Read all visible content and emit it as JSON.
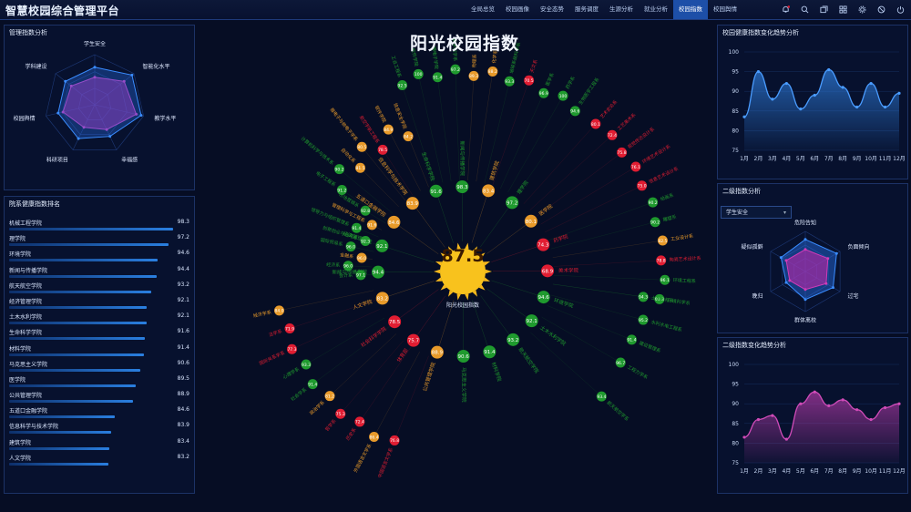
{
  "app": {
    "title": "智慧校园综合管理平台"
  },
  "nav": {
    "tabs": [
      "全局总览",
      "校园画像",
      "安全态势",
      "服务调度",
      "生源分析",
      "就业分析",
      "校园指数",
      "校园舆情"
    ],
    "active_index": 6
  },
  "top_icons": [
    "notification-bell-icon",
    "search-icon",
    "window-icon",
    "grid-icon",
    "settings-gear-icon",
    "block-icon",
    "power-icon"
  ],
  "left_top": {
    "title": "管理指数分析",
    "radar": {
      "labels": [
        "学生安全",
        "智能化水平",
        "教学水平",
        "幸福感",
        "科研项目",
        "校园舆情",
        "学科建设"
      ],
      "series": [
        [
          0.55,
          0.75,
          0.85,
          0.55,
          0.5,
          0.65,
          0.6
        ],
        [
          0.75,
          0.95,
          0.95,
          0.7,
          0.75,
          0.75,
          0.75
        ]
      ]
    }
  },
  "left_bottom": {
    "title": "院系健康指数排名",
    "items": [
      {
        "name": "机械工程学院",
        "value": 98.3
      },
      {
        "name": "理学院",
        "value": 97.2
      },
      {
        "name": "环境学院",
        "value": 94.6
      },
      {
        "name": "新闻与传播学院",
        "value": 94.4
      },
      {
        "name": "航天航空学院",
        "value": 93.2
      },
      {
        "name": "经济管理学院",
        "value": 92.1
      },
      {
        "name": "土木水利学院",
        "value": 92.1
      },
      {
        "name": "生命科学学院",
        "value": 91.6
      },
      {
        "name": "材料学院",
        "value": 91.4
      },
      {
        "name": "马克思主义学院",
        "value": 90.6
      },
      {
        "name": "医学院",
        "value": 89.5
      },
      {
        "name": "公共管理学院",
        "value": 88.9
      },
      {
        "name": "五道口金融学院",
        "value": 84.6
      },
      {
        "name": "信息科学与技术学院",
        "value": 83.9
      },
      {
        "name": "建筑学院",
        "value": 83.4
      },
      {
        "name": "人文学院",
        "value": 83.2
      }
    ]
  },
  "center": {
    "title": "阳光校园指数",
    "score": "87.5",
    "score_label": "阳光校园指数",
    "inner_nodes": [
      {
        "name": "经济管理学院",
        "value": "92.1",
        "status": "green"
      },
      {
        "name": "五道口金融学院",
        "value": "84.6",
        "status": "orange"
      },
      {
        "name": "信息科学与技术学院",
        "value": "83.9",
        "status": "orange"
      },
      {
        "name": "生命科学学院",
        "value": "91.6",
        "status": "green"
      },
      {
        "name": "新闻与传播学院",
        "value": "98.3",
        "status": "green"
      },
      {
        "name": "建筑学院",
        "value": "83.4",
        "status": "orange"
      },
      {
        "name": "理学院",
        "value": "97.2",
        "status": "green"
      },
      {
        "name": "医学院",
        "value": "80.1",
        "status": "orange"
      },
      {
        "name": "药学院",
        "value": "74.3",
        "status": "red"
      },
      {
        "name": "美术学院",
        "value": "68.9",
        "status": "red"
      },
      {
        "name": "环境学院",
        "value": "94.6",
        "status": "green"
      },
      {
        "name": "土木水利学院",
        "value": "92.1",
        "status": "green"
      },
      {
        "name": "航天航空学院",
        "value": "93.2",
        "status": "green"
      },
      {
        "name": "材料学院",
        "value": "91.4",
        "status": "green"
      },
      {
        "name": "马克思主义学院",
        "value": "90.6",
        "status": "green"
      },
      {
        "name": "公共管理学院",
        "value": "88.9",
        "status": "orange"
      },
      {
        "name": "体育部",
        "value": "75.7",
        "status": "red"
      },
      {
        "name": "社会科学学院",
        "value": "78.5",
        "status": "red"
      },
      {
        "name": "人文学院",
        "value": "83.2",
        "status": "orange"
      },
      {
        "name": "新能与传播学院",
        "value": "94.4",
        "status": "green"
      }
    ],
    "outer_groups": [
      {
        "labels": [
          "会计系",
          "经济系",
          "金融系",
          "国际贸易系",
          "创新创业与战略系",
          "领导力与组织管理系",
          "管理科学与工程系",
          "市场营销系"
        ],
        "values": [
          "97.1",
          "96.0",
          "96.0",
          "96.0",
          "92.3",
          "91.4",
          "91.6",
          "92.8"
        ],
        "status": [
          "green",
          "green",
          "orange",
          "green",
          "green",
          "green",
          "orange",
          "green"
        ]
      },
      {
        "labels": [
          "电子工程系",
          "计算机科学与技术系",
          "自动化系",
          "微电子与纳电子学系",
          "航空宇航工程系",
          "软件学院",
          "信息安全学院"
        ],
        "values": [
          "91.2",
          "90.2",
          "81.5",
          "80.5",
          "78.5",
          "84.9",
          "84.2"
        ],
        "status": [
          "green",
          "green",
          "orange",
          "orange",
          "red",
          "orange",
          "orange"
        ]
      },
      {
        "labels": [
          "工业工程系",
          "软件学院",
          "微电子学院",
          "数学科学系",
          "物理系",
          "化学系",
          "地球系统科学系",
          "天文系",
          "医学系",
          "药学系",
          "生物医学工程系"
        ],
        "values": [
          "92.5",
          "100",
          "91.4",
          "97.2",
          "89.3",
          "88.2",
          "93.3",
          "70.5",
          "96.9",
          "100",
          "94.6"
        ],
        "status": [
          "green",
          "green",
          "green",
          "green",
          "orange",
          "orange",
          "green",
          "red",
          "green",
          "green",
          "green"
        ]
      },
      {
        "labels": [
          "艺术史论系",
          "工艺美术系",
          "视觉传达设计系",
          "环境艺术设计系",
          "信息艺术设计系",
          "绘画系",
          "雕塑系",
          "工业设计系",
          "陶瓷艺术设计系",
          "环境工程系",
          "环境科学系"
        ],
        "values": [
          "80.1",
          "72.4",
          "75.8",
          "76.1",
          "75.0",
          "90.2",
          "90.2",
          "82.5",
          "78.8",
          "96.1",
          "93.3"
        ],
        "status": [
          "red",
          "red",
          "red",
          "red",
          "red",
          "green",
          "green",
          "orange",
          "red",
          "green",
          "green"
        ]
      },
      {
        "labels": [
          "土木工程系",
          "水利水电工程系",
          "建设管理系"
        ],
        "values": [
          "94.3",
          "95.2",
          "91.4"
        ],
        "status": [
          "green",
          "green",
          "green"
        ]
      },
      {
        "labels": [
          "工程力学系",
          "航天航空学系"
        ],
        "values": [
          "96.7",
          "93.4"
        ],
        "status": [
          "green",
          "green"
        ]
      },
      {
        "labels": [
          "中国语言文学系",
          "外国语言文学系",
          "历史系",
          "哲学系",
          "政治学系",
          "社会学系",
          "心理学系",
          "国际关系学系",
          "法学系",
          "经济学系"
        ],
        "values": [
          "76.8",
          "86.4",
          "72.4",
          "75.3",
          "81.2",
          "91.4",
          "93.3",
          "77.3",
          "71.9",
          "84.0"
        ],
        "status": [
          "red",
          "orange",
          "red",
          "red",
          "orange",
          "green",
          "green",
          "red",
          "red",
          "orange"
        ]
      }
    ]
  },
  "right_top": {
    "title": "校园健康指数变化趋势分析",
    "chart_data": {
      "type": "area",
      "categories": [
        "1月",
        "2月",
        "3月",
        "4月",
        "5月",
        "6月",
        "7月",
        "8月",
        "9月",
        "10月",
        "11月",
        "12月"
      ],
      "values": [
        83.5,
        95,
        88,
        92,
        85.5,
        89,
        95.5,
        91,
        86,
        92,
        86,
        89.5
      ],
      "ylim": [
        75,
        100
      ],
      "yticks": [
        75,
        80,
        85,
        90,
        95,
        100
      ]
    }
  },
  "right_mid": {
    "title": "二级指数分析",
    "select_value": "学生安全",
    "radar": {
      "labels": [
        "危险告知",
        "负面倾向",
        "过宅",
        "群体离校",
        "晚归",
        "疑似孤僻"
      ],
      "series": [
        [
          0.8,
          0.9,
          0.8,
          0.7,
          0.55,
          0.7
        ],
        [
          0.55,
          0.65,
          0.6,
          0.45,
          0.45,
          0.55
        ]
      ]
    }
  },
  "right_bottom": {
    "title": "二级指数变化趋势分析",
    "chart_data": {
      "type": "area",
      "categories": [
        "1月",
        "2月",
        "3月",
        "4月",
        "5月",
        "6月",
        "7月",
        "8月",
        "9月",
        "10月",
        "11月",
        "12月"
      ],
      "values": [
        81.5,
        86,
        87,
        81,
        90,
        93,
        89.5,
        91,
        88.5,
        86,
        89,
        90
      ],
      "ylim": [
        75,
        100
      ],
      "yticks": [
        75,
        80,
        85,
        90,
        95,
        100
      ]
    }
  },
  "colors": {
    "green": "#1f9a2e",
    "orange": "#e89a2a",
    "red": "#e11d32",
    "accent": "#1d4fa8",
    "area_blue": "#2f7fe0",
    "area_pink": "#b23aa8"
  }
}
